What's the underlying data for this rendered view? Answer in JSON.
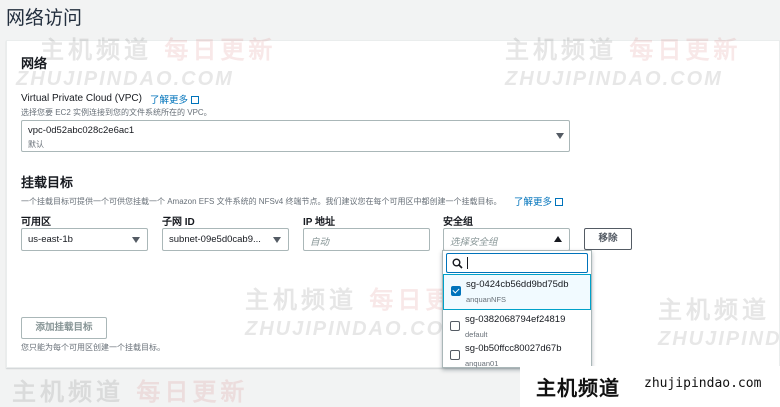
{
  "page": {
    "title": "网络访问"
  },
  "network": {
    "heading": "网络",
    "vpc": {
      "label": "Virtual Private Cloud (VPC)",
      "learn_more": "了解更多",
      "description": "选择您要 EC2 实例连接到您的文件系统所在的 VPC。",
      "selected_value": "vpc-0d52abc028c2e6ac1",
      "selected_sub": "默认"
    }
  },
  "mount_targets": {
    "heading": "挂载目标",
    "description": "一个挂载目标可提供一个可供您挂载一个 Amazon EFS 文件系统的 NFSv4 终端节点。我们建议您在每个可用区中都创建一个挂载目标。",
    "learn_more": "了解更多",
    "columns": {
      "az": "可用区",
      "subnet": "子网 ID",
      "ip": "IP 地址",
      "sg": "安全组"
    },
    "row": {
      "az": "us-east-1b",
      "subnet": "subnet-09e5d0cab9...",
      "ip_placeholder": "自动",
      "sg_placeholder": "选择安全组",
      "remove_label": "移除"
    },
    "add_button": "添加挂载目标",
    "footer_note": "您只能为每个可用区创建一个挂载目标。"
  },
  "sg_dropdown": {
    "search_value": "",
    "options": [
      {
        "name": "sg-0424cb56dd9bd75db",
        "sub": "anquanNFS",
        "checked": true
      },
      {
        "name": "sg-0382068794ef24819",
        "sub": "default",
        "checked": false
      },
      {
        "name": "sg-0b50ffcc80027d67b",
        "sub": "anquan01",
        "checked": false
      }
    ]
  },
  "watermark": {
    "cn1": "主机频道",
    "cn2": "每日更新",
    "en": "ZHUJIPINDAO.COM"
  },
  "brand": {
    "cn": "主机频道",
    "url": "zhujipindao.com"
  },
  "colors": {
    "link": "#0073bb",
    "checkbox": "#0073bb",
    "panel_bg": "#ffffff",
    "page_bg": "#f2f3f3"
  }
}
